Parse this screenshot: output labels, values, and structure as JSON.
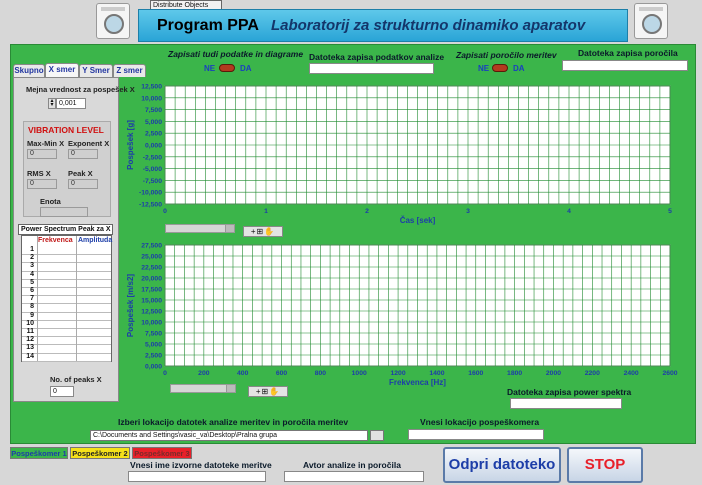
{
  "header": {
    "distribute_label": "Distribute Objects",
    "title_main": "Program PPA",
    "title_sub": "Laboratorij za strukturno dinamiko aparatov"
  },
  "top_controls": {
    "save_data_label": "Zapisati tudi podatke in diagrame",
    "save_data_no": "NE",
    "save_data_yes": "DA",
    "analysis_file_label": "Datoteka zapisa podatkov analize",
    "save_report_label": "Zapisati poročilo meritev",
    "save_report_no": "NE",
    "save_report_yes": "DA",
    "report_file_label": "Datoteka zapisa poročila"
  },
  "tabs": [
    {
      "label": "Skupno",
      "active": false
    },
    {
      "label": "X smer",
      "active": true
    },
    {
      "label": "Y Smer",
      "active": false
    },
    {
      "label": "Z smer",
      "active": false
    }
  ],
  "left_panel": {
    "threshold_label": "Mejna vrednost za pospešek X",
    "threshold_value": "0,001",
    "vib_title": "VIBRATION LEVEL",
    "maxmin_label": "Max-Min X",
    "maxmin_value": "0",
    "exponent_label": "Exponent X",
    "exponent_value": "0",
    "rms_label": "RMS X",
    "rms_value": "0",
    "peak_label": "Peak X",
    "peak_value": "0",
    "unit_label": "Enota",
    "ps_title": "Power Spectrum Peak za X",
    "ps_col_freq": "Frekvenca",
    "ps_col_amp": "Amplituda",
    "ps_rows": [
      "1",
      "2",
      "3",
      "4",
      "5",
      "6",
      "7",
      "8",
      "9",
      "10",
      "11",
      "12",
      "13",
      "14"
    ],
    "peaks_label": "No. of peaks X",
    "peaks_value": "0"
  },
  "chart_data": [
    {
      "type": "line",
      "title": "",
      "xlabel": "Čas [sek]",
      "ylabel": "Pospešek [g]",
      "xlim": [
        0,
        5
      ],
      "ylim": [
        -12500,
        12500
      ],
      "x_ticks": [
        "0",
        "1",
        "2",
        "3",
        "4",
        "5"
      ],
      "y_ticks": [
        "12,500",
        "10,000",
        "7,500",
        "5,000",
        "2,500",
        "0,000",
        "-2,500",
        "-5,000",
        "-7,500",
        "-10,000",
        "-12,500"
      ],
      "grid": true,
      "series": []
    },
    {
      "type": "line",
      "title": "",
      "xlabel": "Frekvenca [Hz]",
      "ylabel": "Pospešek [m/s2]",
      "xlim": [
        0,
        2600
      ],
      "ylim": [
        0,
        27500
      ],
      "x_ticks": [
        "0",
        "200",
        "400",
        "600",
        "800",
        "1000",
        "1200",
        "1400",
        "1600",
        "1800",
        "2000",
        "2200",
        "2400",
        "2600"
      ],
      "y_ticks": [
        "27,500",
        "25,000",
        "22,500",
        "20,000",
        "17,500",
        "15,000",
        "12,500",
        "10,000",
        "7,500",
        "5,000",
        "2,500",
        "0,000"
      ],
      "grid": true,
      "series": []
    }
  ],
  "graph_tools": "+⊞✋",
  "bottom": {
    "spectrum_file_label": "Datoteka zapisa power spektra",
    "location_label": "Izberi lokacijo datotek analize meritev in poročila meritev",
    "location_value": "C:\\Documents and Settings\\vasic_va\\Desktop\\Pralna grupa",
    "sensor_location_label": "Vnesi lokacijo pospeškomera",
    "source_file_label": "Vnesi ime izvorne datoteke meritve",
    "author_label": "Avtor analize in poročila",
    "bottom_tabs": [
      {
        "label": "Pospeškomer 1",
        "bg": "#3bb54a",
        "fg": "#1d3ea8"
      },
      {
        "label": "Pospeškomer 2",
        "bg": "#f5e11a",
        "fg": "#222"
      },
      {
        "label": "Pospeškomer 3",
        "bg": "#e8202a",
        "fg": "#7a2a2a"
      }
    ],
    "open_button": "Odpri datoteko",
    "stop_button": "STOP"
  },
  "colors": {
    "panel_green": "#3bb54a",
    "title_blue": "#2aa4d6",
    "accent_red": "#e8202a",
    "axis_blue": "#1d3ea8",
    "grid_green": "#1e8a2e"
  }
}
